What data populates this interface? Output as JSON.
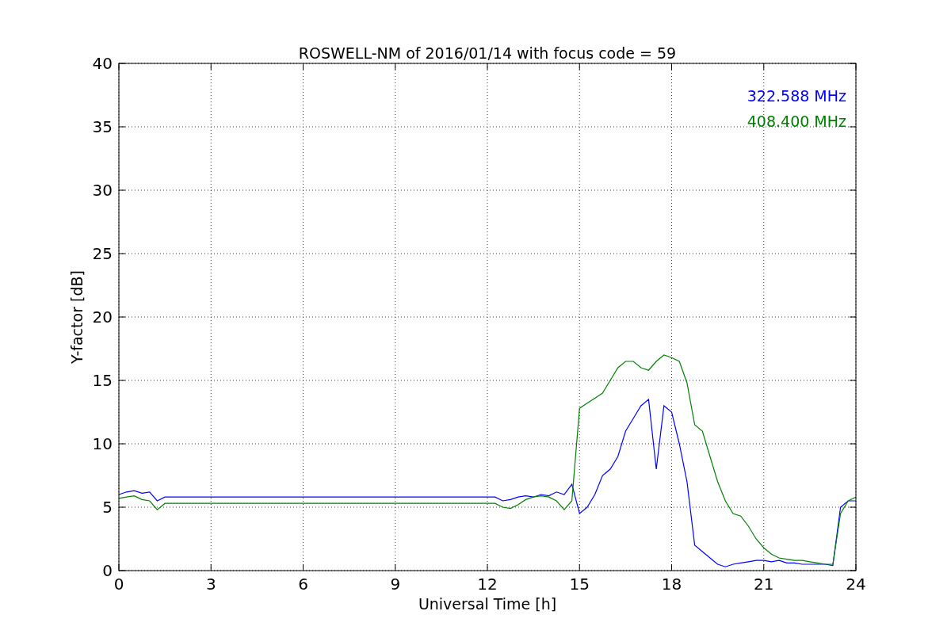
{
  "plot": {
    "chart_data": {
      "type": "line",
      "title": "ROSWELL-NM of 2016/01/14 with focus code = 59",
      "xlabel": "Universal Time [h]",
      "ylabel": "Y-factor [dB]",
      "x": [
        0,
        0.25,
        0.5,
        0.75,
        1,
        1.25,
        1.5,
        1.75,
        2,
        2.25,
        2.5,
        2.75,
        3,
        3.25,
        3.5,
        3.75,
        4,
        4.25,
        4.5,
        4.75,
        5,
        5.25,
        5.5,
        5.75,
        6,
        6.25,
        6.5,
        6.75,
        7,
        7.25,
        7.5,
        7.75,
        8,
        8.25,
        8.5,
        8.75,
        9,
        9.25,
        9.5,
        9.75,
        10,
        10.25,
        10.5,
        10.75,
        11,
        11.25,
        11.5,
        11.75,
        12,
        12.25,
        12.5,
        12.75,
        13,
        13.25,
        13.5,
        13.75,
        14,
        14.25,
        14.5,
        14.75,
        15,
        15.25,
        15.5,
        15.75,
        16,
        16.25,
        16.5,
        16.75,
        17,
        17.25,
        17.5,
        17.75,
        18,
        18.25,
        18.5,
        18.75,
        19,
        19.25,
        19.5,
        19.75,
        20,
        20.25,
        20.5,
        20.75,
        21,
        21.25,
        21.5,
        21.75,
        22,
        22.25,
        22.5,
        22.75,
        23,
        23.25,
        23.5,
        23.75,
        24
      ],
      "series": [
        {
          "name": "322.588 MHz",
          "color": "#0000ff",
          "values": [
            6.0,
            6.2,
            6.3,
            6.1,
            6.2,
            5.5,
            5.8,
            5.8,
            5.8,
            5.8,
            5.8,
            5.8,
            5.8,
            5.8,
            5.8,
            5.8,
            5.8,
            5.8,
            5.8,
            5.8,
            5.8,
            5.8,
            5.8,
            5.8,
            5.8,
            5.8,
            5.8,
            5.8,
            5.8,
            5.8,
            5.8,
            5.8,
            5.8,
            5.8,
            5.8,
            5.8,
            5.8,
            5.8,
            5.8,
            5.8,
            5.8,
            5.8,
            5.8,
            5.8,
            5.8,
            5.8,
            5.8,
            5.8,
            5.8,
            5.8,
            5.5,
            5.6,
            5.8,
            5.9,
            5.8,
            6.0,
            5.9,
            6.2,
            6.0,
            6.8,
            4.5,
            5.0,
            6.0,
            7.5,
            8.0,
            9.0,
            11.0,
            12.0,
            13.0,
            13.5,
            8.0,
            13.0,
            12.5,
            10.0,
            7.0,
            2.0,
            1.5,
            1.0,
            0.5,
            0.3,
            0.5,
            0.6,
            0.7,
            0.8,
            0.8,
            0.7,
            0.8,
            0.6,
            0.6,
            0.5,
            0.5,
            0.5,
            0.5,
            0.4,
            5.0,
            5.5,
            5.5
          ]
        },
        {
          "name": "408.400 MHz",
          "color": "#008000",
          "values": [
            5.7,
            5.8,
            5.9,
            5.6,
            5.5,
            4.8,
            5.3,
            5.3,
            5.3,
            5.3,
            5.3,
            5.3,
            5.3,
            5.3,
            5.3,
            5.3,
            5.3,
            5.3,
            5.3,
            5.3,
            5.3,
            5.3,
            5.3,
            5.3,
            5.3,
            5.3,
            5.3,
            5.3,
            5.3,
            5.3,
            5.3,
            5.3,
            5.3,
            5.3,
            5.3,
            5.3,
            5.3,
            5.3,
            5.3,
            5.3,
            5.3,
            5.3,
            5.3,
            5.3,
            5.3,
            5.3,
            5.3,
            5.3,
            5.3,
            5.3,
            5.0,
            4.9,
            5.2,
            5.6,
            5.8,
            5.9,
            5.8,
            5.5,
            4.8,
            5.5,
            12.8,
            13.2,
            13.6,
            14.0,
            15.0,
            16.0,
            16.5,
            16.5,
            16.0,
            15.8,
            16.5,
            17.0,
            16.8,
            16.5,
            14.8,
            11.5,
            11.0,
            9.0,
            7.0,
            5.5,
            4.5,
            4.3,
            3.5,
            2.5,
            1.8,
            1.3,
            1.0,
            0.9,
            0.8,
            0.8,
            0.7,
            0.6,
            0.5,
            0.5,
            4.5,
            5.5,
            5.8
          ]
        }
      ],
      "xlim": [
        0,
        24
      ],
      "ylim": [
        0,
        40
      ],
      "xticks": [
        0,
        3,
        6,
        9,
        12,
        15,
        18,
        21,
        24
      ],
      "yticks": [
        0,
        5,
        10,
        15,
        20,
        25,
        30,
        35,
        40
      ],
      "grid": true
    }
  }
}
